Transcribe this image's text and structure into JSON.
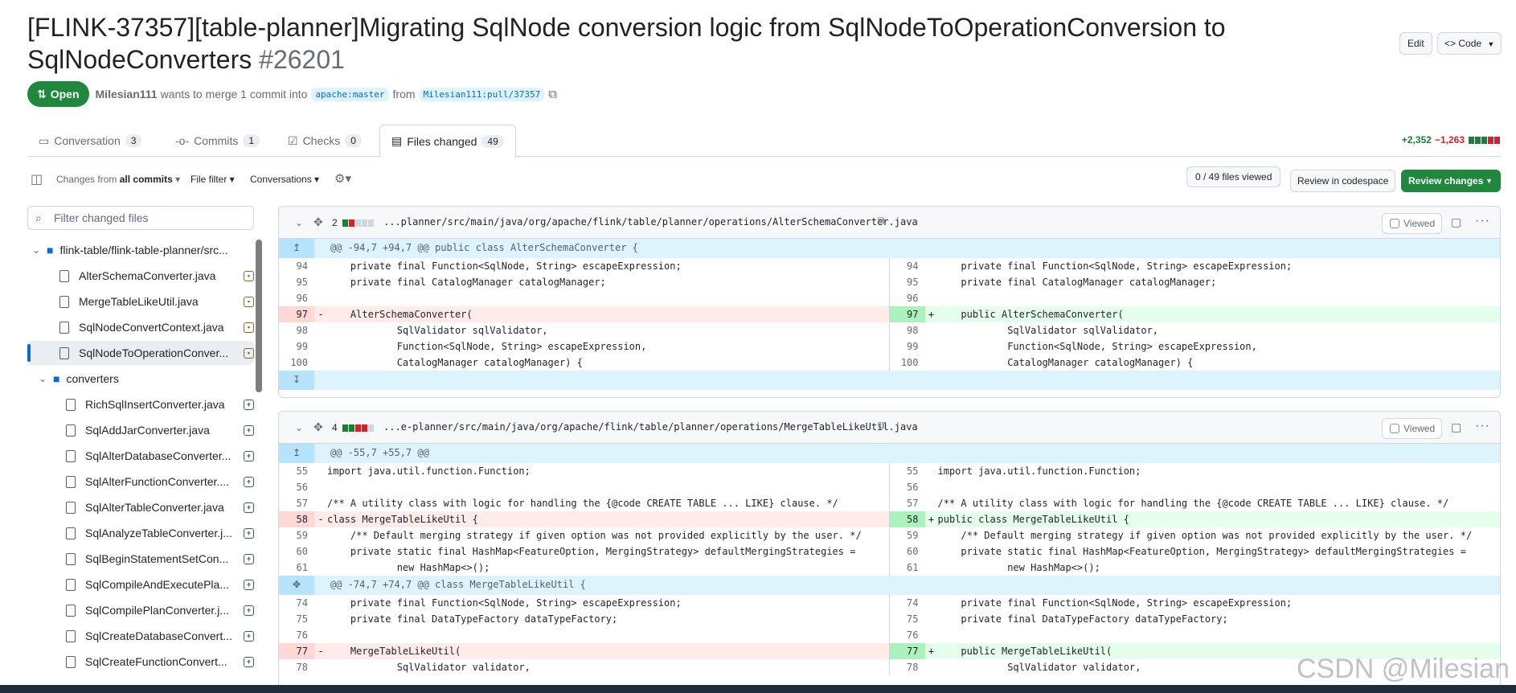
{
  "pr": {
    "title": "[FLINK-37357][table-planner]Migrating SqlNode conversion logic from SqlNodeToOperationConversion to SqlNodeConverters",
    "number": "#26201",
    "state": "Open",
    "author": "Milesian111",
    "merge_text": "wants to merge 1 commit into",
    "base_branch": "apache:master",
    "from_text": "from",
    "head_branch": "Milesian111:pull/37357",
    "edit_label": "Edit",
    "code_label": "Code"
  },
  "tabs": [
    {
      "label": "Conversation",
      "count": "3"
    },
    {
      "label": "Commits",
      "count": "1"
    },
    {
      "label": "Checks",
      "count": "0"
    },
    {
      "label": "Files changed",
      "count": "49"
    }
  ],
  "diffstat": {
    "additions": "+2,352",
    "deletions": "−1,263"
  },
  "toolbar": {
    "changes_from": "Changes from",
    "all_commits": "all commits",
    "file_filter": "File filter",
    "conversations": "Conversations",
    "viewed_count": "0 / 49 files viewed",
    "review_codespace": "Review in codespace",
    "review_changes": "Review changes"
  },
  "tree": {
    "filter_placeholder": "Filter changed files",
    "root_folder": "flink-table/flink-table-planner/src...",
    "files_top": [
      {
        "name": "AlterSchemaConverter.java"
      },
      {
        "name": "MergeTableLikeUtil.java"
      },
      {
        "name": "SqlNodeConvertContext.java"
      },
      {
        "name": "SqlNodeToOperationConver..."
      }
    ],
    "sub_folder": "converters",
    "files_sub": [
      {
        "name": "RichSqlInsertConverter.java"
      },
      {
        "name": "SqlAddJarConverter.java"
      },
      {
        "name": "SqlAlterDatabaseConverter..."
      },
      {
        "name": "SqlAlterFunctionConverter...."
      },
      {
        "name": "SqlAlterTableConverter.java"
      },
      {
        "name": "SqlAnalyzeTableConverter.j..."
      },
      {
        "name": "SqlBeginStatementSetCon..."
      },
      {
        "name": "SqlCompileAndExecutePla..."
      },
      {
        "name": "SqlCompilePlanConverter.j..."
      },
      {
        "name": "SqlCreateDatabaseConvert..."
      },
      {
        "name": "SqlCreateFunctionConvert..."
      }
    ]
  },
  "files": [
    {
      "changes": "2",
      "path": "...planner/src/main/java/org/apache/flink/table/planner/operations/AlterSchemaConverter.java",
      "viewed_label": "Viewed",
      "hunk": "@@ -94,7 +94,7 @@ public class AlterSchemaConverter {",
      "lines": [
        {
          "l": "94",
          "r": "94",
          "lc": "    private final Function<SqlNode, String> escapeExpression;",
          "rc": "    private final Function<SqlNode, String> escapeExpression;"
        },
        {
          "l": "95",
          "r": "95",
          "lc": "    private final CatalogManager catalogManager;",
          "rc": "    private final CatalogManager catalogManager;"
        },
        {
          "l": "96",
          "r": "96",
          "lc": "",
          "rc": ""
        },
        {
          "l": "97",
          "r": "97",
          "lc": "    AlterSchemaConverter(",
          "rc": "    public AlterSchemaConverter(",
          "ls": "-",
          "rs": "+"
        },
        {
          "l": "98",
          "r": "98",
          "lc": "            SqlValidator sqlValidator,",
          "rc": "            SqlValidator sqlValidator,"
        },
        {
          "l": "99",
          "r": "99",
          "lc": "            Function<SqlNode, String> escapeExpression,",
          "rc": "            Function<SqlNode, String> escapeExpression,"
        },
        {
          "l": "100",
          "r": "100",
          "lc": "            CatalogManager catalogManager) {",
          "rc": "            CatalogManager catalogManager) {"
        }
      ]
    },
    {
      "changes": "4",
      "path": "...e-planner/src/main/java/org/apache/flink/table/planner/operations/MergeTableLikeUtil.java",
      "viewed_label": "Viewed",
      "hunk": "@@ -55,7 +55,7 @@",
      "lines": [
        {
          "l": "55",
          "r": "55",
          "lc": "import java.util.function.Function;",
          "rc": "import java.util.function.Function;"
        },
        {
          "l": "56",
          "r": "56",
          "lc": "",
          "rc": ""
        },
        {
          "l": "57",
          "r": "57",
          "lc": "/** A utility class with logic for handling the {@code CREATE TABLE ... LIKE} clause. */",
          "rc": "/** A utility class with logic for handling the {@code CREATE TABLE ... LIKE} clause. */"
        },
        {
          "l": "58",
          "r": "58",
          "lc": "class MergeTableLikeUtil {",
          "rc": "public class MergeTableLikeUtil {",
          "ls": "-",
          "rs": "+"
        },
        {
          "l": "59",
          "r": "59",
          "lc": "    /** Default merging strategy if given option was not provided explicitly by the user. */",
          "rc": "    /** Default merging strategy if given option was not provided explicitly by the user. */"
        },
        {
          "l": "60",
          "r": "60",
          "lc": "    private static final HashMap<FeatureOption, MergingStrategy> defaultMergingStrategies =",
          "rc": "    private static final HashMap<FeatureOption, MergingStrategy> defaultMergingStrategies ="
        },
        {
          "l": "61",
          "r": "61",
          "lc": "            new HashMap<>();",
          "rc": "            new HashMap<>();"
        }
      ],
      "hunk2": "@@ -74,7 +74,7 @@ class MergeTableLikeUtil {",
      "lines2": [
        {
          "l": "74",
          "r": "74",
          "lc": "    private final Function<SqlNode, String> escapeExpression;",
          "rc": "    private final Function<SqlNode, String> escapeExpression;"
        },
        {
          "l": "75",
          "r": "75",
          "lc": "    private final DataTypeFactory dataTypeFactory;",
          "rc": "    private final DataTypeFactory dataTypeFactory;"
        },
        {
          "l": "76",
          "r": "76",
          "lc": "",
          "rc": ""
        },
        {
          "l": "77",
          "r": "77",
          "lc": "    MergeTableLikeUtil(",
          "rc": "    public MergeTableLikeUtil(",
          "ls": "-",
          "rs": "+"
        },
        {
          "l": "78",
          "r": "78",
          "lc": "            SqlValidator validator,",
          "rc": "            SqlValidator validator,"
        }
      ]
    }
  ],
  "watermark": "CSDN @Milesian",
  "colors": {
    "green": "#1f883d",
    "add_bg": "#e6ffec",
    "del_bg": "#ffebe9",
    "hunk_bg": "#ddf4ff",
    "link": "#0969da"
  },
  "icons": [
    "pull-request-icon",
    "copy-icon",
    "conversation-icon",
    "commit-icon",
    "checks-icon",
    "file-diff-icon",
    "sidebar-toggle-icon",
    "gear-icon",
    "search-icon",
    "folder-icon",
    "file-icon",
    "chevron-down-icon",
    "expand-up-icon",
    "expand-down-icon",
    "move-icon",
    "comment-icon",
    "kebab-icon"
  ]
}
